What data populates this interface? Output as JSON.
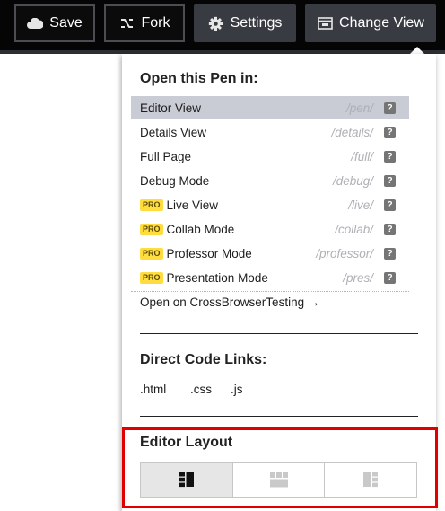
{
  "toolbar": {
    "save_label": "Save",
    "fork_label": "Fork",
    "settings_label": "Settings",
    "change_view_label": "Change View"
  },
  "menu": {
    "open_heading": "Open this Pen in:",
    "items": [
      {
        "label": "Editor View",
        "path": "/pen/",
        "pro": false,
        "selected": true
      },
      {
        "label": "Details View",
        "path": "/details/",
        "pro": false
      },
      {
        "label": "Full Page",
        "path": "/full/",
        "pro": false
      },
      {
        "label": "Debug Mode",
        "path": "/debug/",
        "pro": false
      },
      {
        "label": "Live View",
        "path": "/live/",
        "pro": true
      },
      {
        "label": "Collab Mode",
        "path": "/collab/",
        "pro": true
      },
      {
        "label": "Professor Mode",
        "path": "/professor/",
        "pro": true
      },
      {
        "label": "Presentation Mode",
        "path": "/pres/",
        "pro": true
      }
    ],
    "pro_badge": "PRO",
    "help_glyph": "?",
    "crossbrowser_link": "Open on CrossBrowserTesting →",
    "direct_heading": "Direct Code Links:",
    "code_links": [
      ".html",
      ".css",
      ".js"
    ],
    "layout_heading": "Editor Layout",
    "layout_options": [
      "layout-left-icon",
      "layout-top-icon",
      "layout-right-icon"
    ]
  },
  "colors": {
    "topbar": "#050505",
    "button_filled": "#393b42",
    "selected_row": "#c9cbd5",
    "pro_badge": "#ffdd40",
    "highlight": "#e00000"
  }
}
